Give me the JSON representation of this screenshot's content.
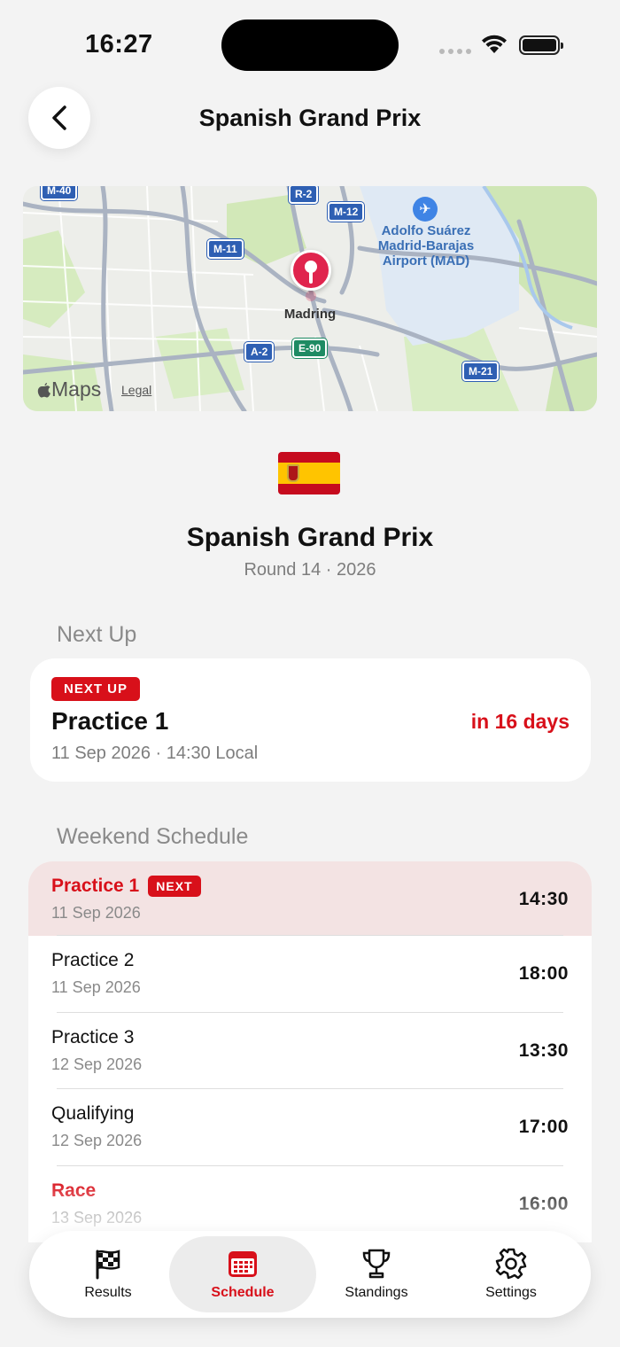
{
  "status_bar": {
    "time": "16:27"
  },
  "header": {
    "title": "Spanish Grand Prix"
  },
  "map": {
    "pin_label": "Madring",
    "airport_label": "Adolfo Suárez Madrid-Barajas Airport (MAD)",
    "brand": "Maps",
    "legal": "Legal",
    "shields": [
      "M-40",
      "R-2",
      "M-12",
      "M-11",
      "A-2",
      "E-90",
      "M-21"
    ]
  },
  "event": {
    "flag_icon": "spain-flag-icon",
    "name": "Spanish Grand Prix",
    "subtitle": "Round 14 · 2026"
  },
  "next_up": {
    "section_title": "Next Up",
    "badge": "NEXT UP",
    "session": "Practice 1",
    "date": "11 Sep 2026 · 14:30 Local",
    "countdown": "in 16 days"
  },
  "schedule": {
    "section_title": "Weekend Schedule",
    "next_badge": "NEXT",
    "rows": [
      {
        "name": "Practice 1",
        "date": "11 Sep 2026",
        "time": "14:30"
      },
      {
        "name": "Practice 2",
        "date": "11 Sep 2026",
        "time": "18:00"
      },
      {
        "name": "Practice 3",
        "date": "12 Sep 2026",
        "time": "13:30"
      },
      {
        "name": "Qualifying",
        "date": "12 Sep 2026",
        "time": "17:00"
      },
      {
        "name": "Race",
        "date": "13 Sep 2026",
        "time": "16:00"
      }
    ]
  },
  "tabs": [
    {
      "label": "Results",
      "icon": "checkered-flag-icon"
    },
    {
      "label": "Schedule",
      "icon": "calendar-icon"
    },
    {
      "label": "Standings",
      "icon": "trophy-icon"
    },
    {
      "label": "Settings",
      "icon": "gear-icon"
    }
  ],
  "colors": {
    "accent": "#d8101a",
    "highlight_row": "#f3e3e3",
    "background": "#f3f3f3"
  }
}
